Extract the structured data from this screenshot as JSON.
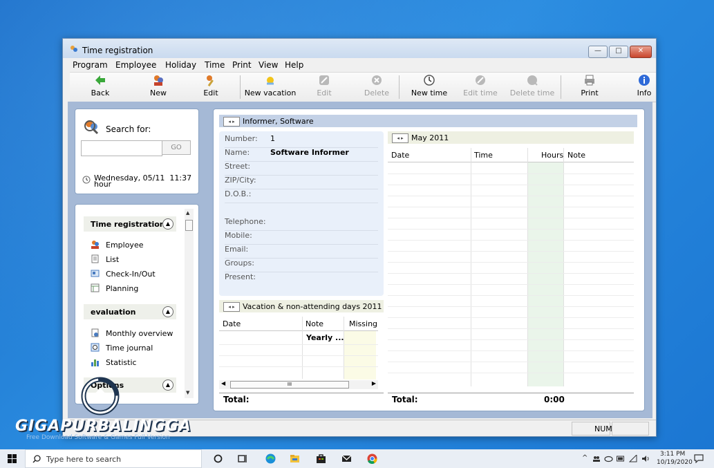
{
  "window": {
    "title": "Time registration",
    "controls": {
      "minimize": "—",
      "maximize": "□",
      "close": "✕"
    }
  },
  "menu": [
    "Program",
    "Employee",
    "Holiday",
    "Time",
    "Print",
    "View",
    "Help"
  ],
  "toolbar": [
    {
      "label": "Back",
      "icon": "back-arrow-icon",
      "enabled": true
    },
    {
      "label": "New",
      "icon": "new-employee-icon",
      "enabled": true
    },
    {
      "label": "Edit",
      "icon": "edit-employee-icon",
      "enabled": true
    },
    {
      "label": "New vacation",
      "icon": "new-vacation-icon",
      "enabled": true
    },
    {
      "label": "Edit",
      "icon": "edit-vacation-icon",
      "enabled": false
    },
    {
      "label": "Delete",
      "icon": "delete-vacation-icon",
      "enabled": false
    },
    {
      "label": "New time",
      "icon": "new-time-icon",
      "enabled": true
    },
    {
      "label": "Edit time",
      "icon": "edit-time-icon",
      "enabled": false
    },
    {
      "label": "Delete time",
      "icon": "delete-time-icon",
      "enabled": false
    },
    {
      "label": "Print",
      "icon": "print-icon",
      "enabled": true
    },
    {
      "label": "Info",
      "icon": "info-icon",
      "enabled": true
    }
  ],
  "search": {
    "label": "Search for:",
    "placeholder": "",
    "go_label": "GO",
    "datetime": "Wednesday, 05/11  11:37",
    "datetime_suffix": "hour"
  },
  "nav": {
    "sections": [
      {
        "title": "Time registration",
        "items": [
          "Employee",
          "List",
          "Check-In/Out",
          "Planning"
        ]
      },
      {
        "title": "evaluation",
        "items": [
          "Monthly overview",
          "Time journal",
          "Statistic"
        ]
      },
      {
        "title": "Options",
        "items": []
      }
    ]
  },
  "employee": {
    "header": "Informer, Software",
    "fields": [
      {
        "label": "Number:",
        "value": "1",
        "bold": false
      },
      {
        "label": "Name:",
        "value": "Software Informer",
        "bold": true
      },
      {
        "label": "Street:",
        "value": ""
      },
      {
        "label": "ZIP/City:",
        "value": ""
      },
      {
        "label": "D.O.B.:",
        "value": ""
      },
      {
        "label": "Telephone:",
        "value": ""
      },
      {
        "label": "Mobile:",
        "value": ""
      },
      {
        "label": "Email:",
        "value": ""
      },
      {
        "label": "Groups:",
        "value": ""
      },
      {
        "label": "Present:",
        "value": ""
      }
    ]
  },
  "vacation": {
    "header": "Vacation & non-attending days 2011",
    "columns": [
      "Date",
      "Note",
      "Missing"
    ],
    "rows": [
      {
        "date": "",
        "note": "Yearly ...",
        "missing": ""
      }
    ],
    "scroll_mark": "III",
    "total_label": "Total:"
  },
  "month": {
    "header": "May 2011",
    "columns": [
      "Date",
      "Time",
      "Hours",
      "Note"
    ],
    "total_label": "Total:",
    "total_hours": "0:00"
  },
  "statusbar": {
    "num": "NUM"
  },
  "watermark": {
    "brand": "GIGAPURBALINGGA",
    "tagline": "Free Download Software & Games Full Version"
  },
  "taskbar": {
    "search_placeholder": "Type here to search",
    "time": "3:11 PM",
    "date": "10/19/2020"
  },
  "colors": {
    "window_bg": "#f0f0f0",
    "panel_border": "#8aa3c3",
    "header_blue": "#c3d1e6",
    "info_bg": "#e9f0fa",
    "hours_col": "#eaf5ea"
  }
}
